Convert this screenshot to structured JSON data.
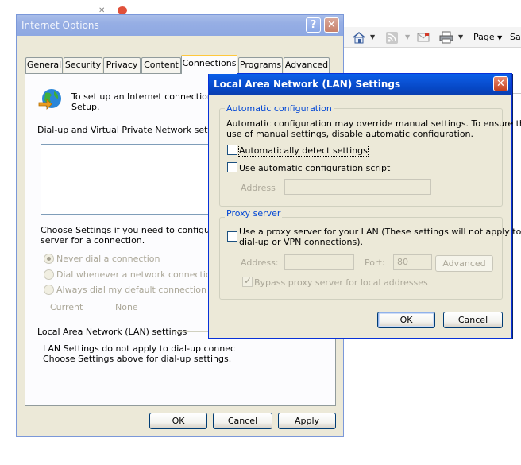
{
  "browser": {
    "page_label": "Page",
    "safety_label": "Saf"
  },
  "internet_options": {
    "title": "Internet Options",
    "help_glyph": "?",
    "close_glyph": "✕",
    "tabs": [
      "General",
      "Security",
      "Privacy",
      "Content",
      "Connections",
      "Programs",
      "Advanced"
    ],
    "selected_tab": "Connections",
    "setup_text": "To set up an Internet connection, cl",
    "setup_text_2": "Setup.",
    "dialup_heading": "Dial-up and Virtual Private Network settings",
    "choose_text_1": "Choose Settings if you need to configure a p",
    "choose_text_2": "server for a connection.",
    "radio_never": "Never dial a connection",
    "radio_whenever": "Dial whenever a network connection is n",
    "radio_always": "Always dial my default connection",
    "current_label": "Current",
    "current_value": "None",
    "lan_heading": "Local Area Network (LAN) settings",
    "lan_text_1": "LAN Settings do not apply to dial-up connec",
    "lan_text_2": "Choose Settings above for dial-up settings.",
    "ok_label": "OK",
    "cancel_label": "Cancel",
    "apply_label": "Apply"
  },
  "lan_dialog": {
    "title": "Local Area Network (LAN) Settings",
    "close_glyph": "✕",
    "auto_group_title": "Automatic configuration",
    "auto_desc_1": "Automatic configuration may override manual settings.  To ensure the",
    "auto_desc_2": "use of manual settings, disable automatic configuration.",
    "auto_detect_label": "Automatically detect settings",
    "auto_script_label": "Use automatic configuration script",
    "address_label": "Address",
    "address_value": "",
    "proxy_group_title": "Proxy server",
    "proxy_use_label_1": "Use a proxy server for your LAN (These settings will not apply to",
    "proxy_use_label_2": "dial-up or VPN connections).",
    "proxy_address_label": "Address:",
    "proxy_address_value": "",
    "port_label": "Port:",
    "port_value": "80",
    "advanced_label": "Advanced",
    "bypass_label": "Bypass proxy server for local addresses",
    "ok_label": "OK",
    "cancel_label": "Cancel",
    "auto_detect_checked": false,
    "auto_script_checked": false,
    "proxy_checked": false,
    "bypass_checked": true
  },
  "colors": {
    "titlebar_active": "#0a56dc",
    "group_title": "#0046d5",
    "dialog_bg": "#ece9d8",
    "tab_highlight": "#ffc83c"
  }
}
